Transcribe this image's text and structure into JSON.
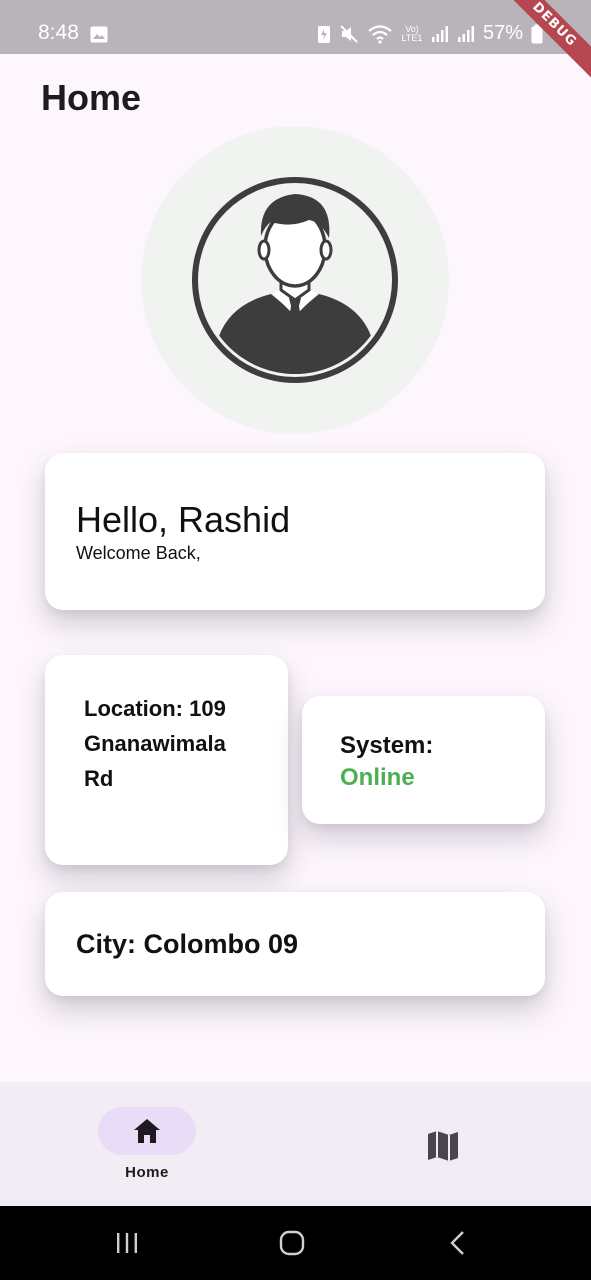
{
  "status_bar": {
    "time": "8:48",
    "battery": "57%",
    "network_label": "Vo) LTE1",
    "debug_label": "DEBUG"
  },
  "page": {
    "title": "Home"
  },
  "greeting": {
    "hello": "Hello, Rashid",
    "welcome": "Welcome Back,"
  },
  "location": {
    "text": "Location: 109 Gnanawimala Rd"
  },
  "system": {
    "label": "System:",
    "status": "Online",
    "status_color": "#4caf50"
  },
  "city": {
    "text": "City: Colombo 09"
  },
  "bottom_nav": {
    "items": [
      {
        "label": "Home",
        "icon": "home-icon",
        "selected": true
      },
      {
        "icon": "map-icon",
        "selected": false
      }
    ],
    "selected_pill_color": "#e9dcf7"
  },
  "colors": {
    "background": "#fdf6fd",
    "card": "#ffffff",
    "avatar_bg": "#f1f3f1",
    "avatar_fg": "#3d3d3d"
  }
}
